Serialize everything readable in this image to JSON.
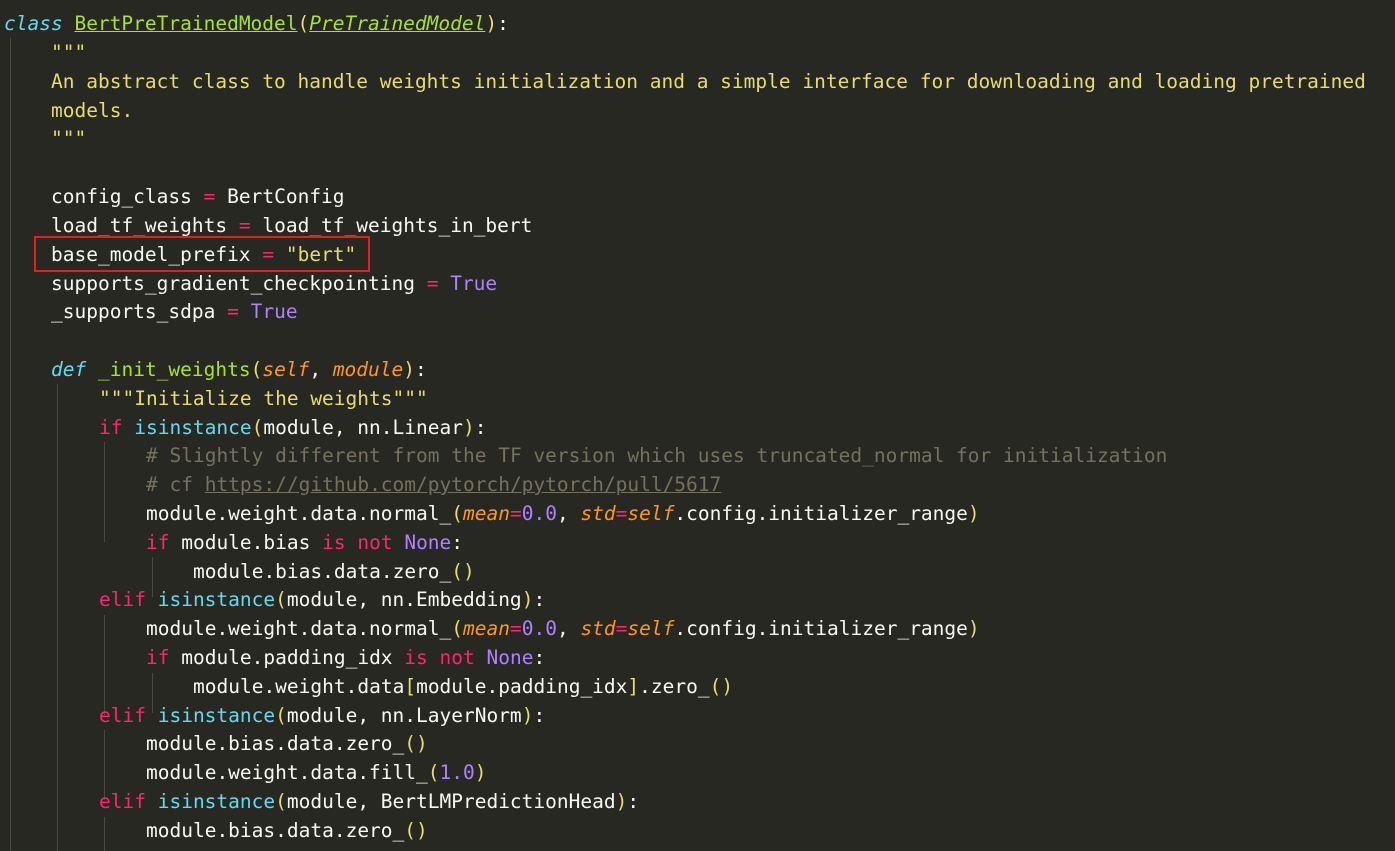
{
  "code": {
    "l1": {
      "kw": "class",
      "name": "BertPreTrainedModel",
      "open": "(",
      "base": "PreTrainedModel",
      "close": ")",
      "colon": ":"
    },
    "l2": {
      "doc": "\"\"\""
    },
    "l3": {
      "doc": "An abstract class to handle weights initialization and a simple interface for downloading and loading pretrained"
    },
    "l4": {
      "doc": "models."
    },
    "l5": {
      "doc": "\"\"\""
    },
    "l6": {
      "name": "config_class",
      "op": "=",
      "value": "BertConfig"
    },
    "l7": {
      "name": "load_tf_weights",
      "op": "=",
      "value": "load_tf_weights_in_bert"
    },
    "l8": {
      "name": "base_model_prefix",
      "op": "=",
      "value": "\"bert\""
    },
    "l9": {
      "name": "supports_gradient_checkpointing",
      "op": "=",
      "value": "True"
    },
    "l10": {
      "name": "_supports_sdpa",
      "op": "=",
      "value": "True"
    },
    "l11": {
      "kw": "def",
      "name": "_init_weights",
      "open": "(",
      "p1": "self",
      "comma": ", ",
      "p2": "module",
      "close": ")",
      "colon": ":"
    },
    "l12": {
      "doc": "\"\"\"Initialize the weights\"\"\""
    },
    "l13": {
      "kw": "if",
      "fn": "isinstance",
      "open": "(",
      "args": "module, nn.Linear",
      "close": ")",
      "colon": ":"
    },
    "l14": {
      "comment": "# Slightly different from the TF version which uses truncated_normal for initialization"
    },
    "l15": {
      "comment": "# cf ",
      "link": "https://github.com/pytorch/pytorch/pull/5617"
    },
    "l16": {
      "pre": "module.weight.data.normal_",
      "open": "(",
      "k1": "mean",
      "eq1": "=",
      "v1": "0.0",
      "sep": ", ",
      "k2": "std",
      "eq2": "=",
      "self": "self",
      "rest": ".config.initializer_range",
      "close": ")"
    },
    "l17": {
      "kw": "if",
      "mid": " module.bias ",
      "is": "is",
      "not": "not",
      "none": "None",
      "colon": ":"
    },
    "l18": {
      "text": "module.bias.data.zero_",
      "call": "()"
    },
    "l19": {
      "kw": "elif",
      "fn": "isinstance",
      "open": "(",
      "args": "module, nn.Embedding",
      "close": ")",
      "colon": ":"
    },
    "l20": {
      "pre": "module.weight.data.normal_",
      "open": "(",
      "k1": "mean",
      "eq1": "=",
      "v1": "0.0",
      "sep": ", ",
      "k2": "std",
      "eq2": "=",
      "self": "self",
      "rest": ".config.initializer_range",
      "close": ")"
    },
    "l21": {
      "kw": "if",
      "mid": " module.padding_idx ",
      "is": "is",
      "not": "not",
      "none": "None",
      "colon": ":"
    },
    "l22": {
      "pre": "module.weight.data",
      "ob": "[",
      "idx": "module.padding_idx",
      "cb": "]",
      "post": ".zero_",
      "call": "()"
    },
    "l23": {
      "kw": "elif",
      "fn": "isinstance",
      "open": "(",
      "args": "module, nn.LayerNorm",
      "close": ")",
      "colon": ":"
    },
    "l24": {
      "text": "module.bias.data.zero_",
      "call": "()"
    },
    "l25": {
      "pre": "module.weight.data.fill_",
      "open": "(",
      "num": "1.0",
      "close": ")"
    },
    "l26": {
      "kw": "elif",
      "fn": "isinstance",
      "open": "(",
      "args": "module, BertLMPredictionHead",
      "close": ")",
      "colon": ":"
    },
    "l27": {
      "text": "module.bias.data.zero_",
      "call": "()"
    }
  },
  "colors": {
    "background": "#272822",
    "highlight_box": "#E02020"
  }
}
